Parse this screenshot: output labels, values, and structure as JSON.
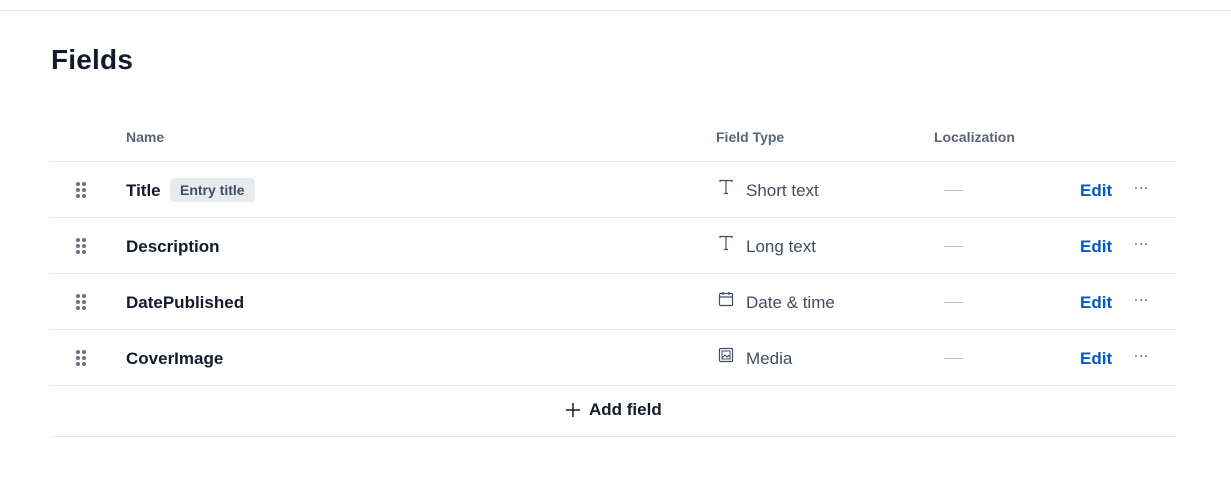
{
  "page": {
    "title": "Fields"
  },
  "columns": {
    "name": "Name",
    "field_type": "Field Type",
    "localization": "Localization"
  },
  "fields": [
    {
      "name": "Title",
      "badge": "Entry title",
      "type_icon": "text-icon",
      "type": "Short text",
      "localization": "—",
      "edit_label": "Edit",
      "more_icon": "more-icon"
    },
    {
      "name": "Description",
      "badge": "",
      "type_icon": "text-icon",
      "type": "Long text",
      "localization": "—",
      "edit_label": "Edit",
      "more_icon": "more-icon"
    },
    {
      "name": "DatePublished",
      "badge": "",
      "type_icon": "calendar-icon",
      "type": "Date & time",
      "localization": "—",
      "edit_label": "Edit",
      "more_icon": "more-icon"
    },
    {
      "name": "CoverImage",
      "badge": "",
      "type_icon": "media-icon",
      "type": "Media",
      "localization": "—",
      "edit_label": "Edit",
      "more_icon": "more-icon"
    }
  ],
  "add_field": {
    "label": "Add field",
    "icon": "plus-icon"
  },
  "colors": {
    "link": "#0059c8",
    "text": "#111b2b",
    "muted": "#414d63",
    "badge_bg": "#e7ebee",
    "divider": "#e5ebed"
  }
}
